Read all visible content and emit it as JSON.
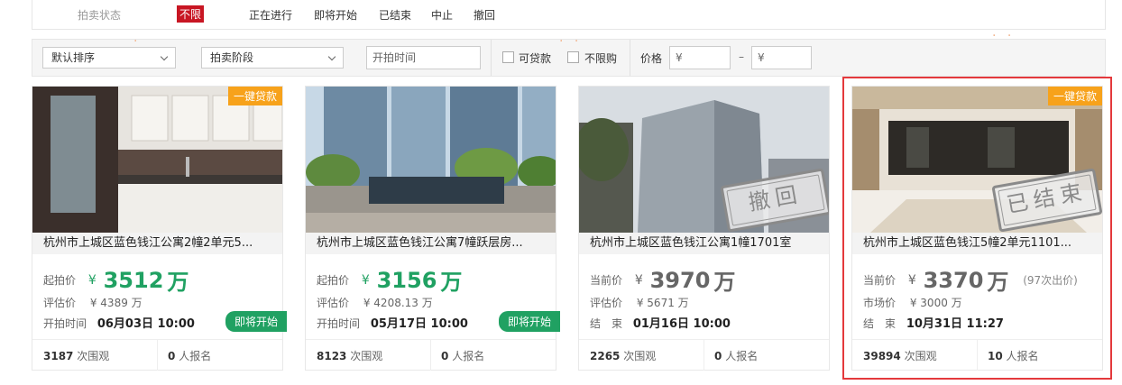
{
  "status": {
    "title": "拍卖状态",
    "options": [
      "不限",
      "正在进行",
      "即将开始",
      "已结束",
      "中止",
      "撤回"
    ]
  },
  "filters": {
    "sort": "默认排序",
    "stage": "拍卖阶段",
    "start_time_placeholder": "开拍时间",
    "loanable": "可贷款",
    "unlimited": "不限购",
    "price_label": "价格",
    "currency": "¥",
    "dash": "–"
  },
  "colors": {
    "accent_red": "#c81623",
    "green": "#20a162",
    "orange": "#f7a21b",
    "highlight": "#e4393c"
  },
  "cards": [
    {
      "tag": "一键贷款",
      "title": "杭州市上城区蓝色钱江公寓2幢2单元5...",
      "price_label": "起拍价",
      "currency": "¥",
      "price": "3512",
      "unit": "万",
      "bid_count": "",
      "eval_label": "评估价",
      "eval_value": "¥ 4389 万",
      "time_label": "开拍时间",
      "time_value": "06月03日 10:00",
      "status_pill": "即将开始",
      "views": "3187",
      "views_label": "次围观",
      "signups": "0",
      "signups_label": "人报名",
      "stamp": ""
    },
    {
      "tag": "",
      "title": "杭州市上城区蓝色钱江公寓7幢跃层房...",
      "price_label": "起拍价",
      "currency": "¥",
      "price": "3156",
      "unit": "万",
      "bid_count": "",
      "eval_label": "评估价",
      "eval_value": "¥ 4208.13 万",
      "time_label": "开拍时间",
      "time_value": "05月17日 10:00",
      "status_pill": "即将开始",
      "views": "8123",
      "views_label": "次围观",
      "signups": "0",
      "signups_label": "人报名",
      "stamp": ""
    },
    {
      "tag": "",
      "title": "杭州市上城区蓝色钱江公寓1幢1701室",
      "price_label": "当前价",
      "currency": "¥",
      "price": "3970",
      "unit": "万",
      "bid_count": "",
      "eval_label": "评估价",
      "eval_value": "¥ 5671 万",
      "time_label": "结　束",
      "time_value": "01月16日 10:00",
      "status_pill": "",
      "views": "2265",
      "views_label": "次围观",
      "signups": "0",
      "signups_label": "人报名",
      "stamp": "撤回"
    },
    {
      "tag": "一键贷款",
      "title": "杭州市上城区蓝色钱江5幢2单元1101...",
      "price_label": "当前价",
      "currency": "¥",
      "price": "3370",
      "unit": "万",
      "bid_count": "(97次出价)",
      "eval_label": "市场价",
      "eval_value": "¥ 3000 万",
      "time_label": "结　束",
      "time_value": "10月31日 11:27",
      "status_pill": "",
      "views": "39894",
      "views_label": "次围观",
      "signups": "10",
      "signups_label": "人报名",
      "stamp": "已结束"
    }
  ]
}
